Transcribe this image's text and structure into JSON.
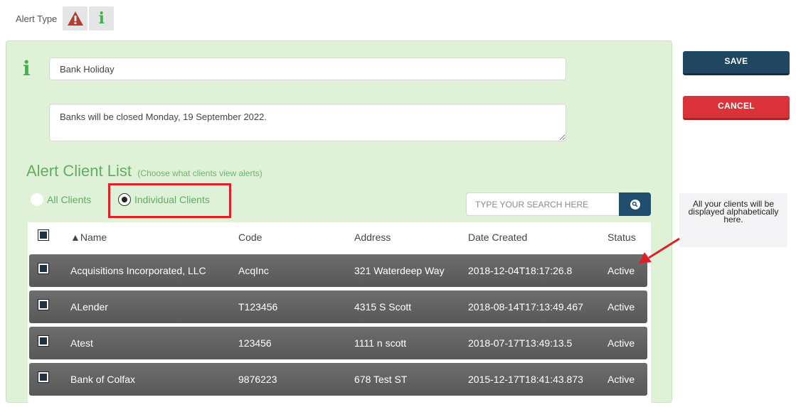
{
  "alert_type": {
    "label": "Alert Type",
    "icons": [
      "warning-icon",
      "info-icon"
    ]
  },
  "form": {
    "title_value": "Bank Holiday",
    "message_value": "Banks will be closed Monday, 19 September 2022."
  },
  "client_list": {
    "heading": "Alert Client List",
    "subheading": "(Choose what clients view alerts)",
    "options": [
      "All Clients",
      "Individual Clients"
    ],
    "selected": "Individual Clients"
  },
  "search": {
    "placeholder": "TYPE YOUR SEARCH HERE"
  },
  "table": {
    "headers": [
      "Name",
      "Code",
      "Address",
      "Date Created",
      "Status"
    ],
    "sort_indicator": "▲",
    "rows": [
      {
        "name": "Acquisitions Incorporated, LLC",
        "code": "AcqInc",
        "address": "321 Waterdeep Way",
        "date": "2018-12-04T18:17:26.8",
        "status": "Active"
      },
      {
        "name": "ALender",
        "code": "T123456",
        "address": "4315 S Scott",
        "date": "2018-08-14T17:13:49.467",
        "status": "Active"
      },
      {
        "name": "Atest",
        "code": "123456",
        "address": "1111 n scott",
        "date": "2018-07-17T13:49:13.5",
        "status": "Active"
      },
      {
        "name": "Bank of Colfax",
        "code": "9876223",
        "address": "678 Test ST",
        "date": "2015-12-17T18:41:43.873",
        "status": "Active"
      }
    ]
  },
  "actions": {
    "save_label": "SAVE",
    "cancel_label": "CANCEL"
  },
  "annotation": {
    "note": "All your clients will be displayed alphabetically here."
  },
  "colors": {
    "panel_bg": "#dff1d7",
    "accent_green": "#5fae62",
    "save": "#1f4761",
    "cancel": "#d9323a",
    "row_bg": "#606060",
    "highlight_red": "#e01f26"
  }
}
